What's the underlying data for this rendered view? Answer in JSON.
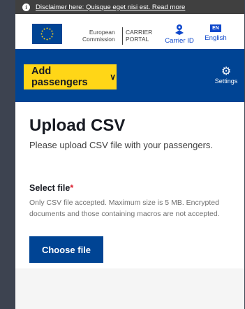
{
  "disclaimer": {
    "text": "Disclaimer here: Quisque eget nisi est. Read more",
    "icon": "info-icon"
  },
  "header": {
    "org_line1": "European",
    "org_line2": "Commission",
    "portal_line1": "CARRIER",
    "portal_line2": "PORTAL",
    "carrier_id_label": "Carrier ID",
    "carrier_id_icon": "user-key-icon",
    "lang_code": "EN",
    "lang_label": "English"
  },
  "navbar": {
    "add_passengers_label": "Add passengers",
    "settings_label": "Settings",
    "settings_icon": "gear-icon"
  },
  "upload": {
    "title": "Upload CSV",
    "subtitle": "Please upload CSV file with your passengers."
  },
  "file_field": {
    "label": "Select file",
    "required_mark": "*",
    "help": "Only CSV file accepted. Maximum size is 5 MB. Encrypted documents and those containing macros are not accepted.",
    "button_label": "Choose file"
  },
  "colors": {
    "brand_blue": "#004494",
    "accent_yellow": "#ffd617",
    "link_blue": "#0e47cb",
    "required_red": "#da2131"
  }
}
